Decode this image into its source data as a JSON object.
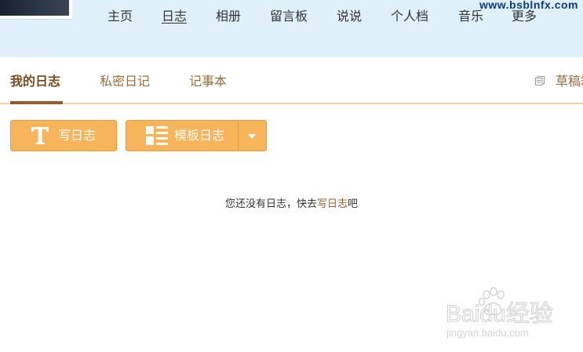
{
  "header": {
    "nav": [
      {
        "label": "主页"
      },
      {
        "label": "日志"
      },
      {
        "label": "相册"
      },
      {
        "label": "留言板"
      },
      {
        "label": "说说"
      },
      {
        "label": "个人档"
      },
      {
        "label": "音乐"
      },
      {
        "label": "更多"
      }
    ],
    "active_nav": "日志",
    "watermark_url": "www.bsblnfx.com"
  },
  "tabs": {
    "items": [
      {
        "label": "我的日志"
      },
      {
        "label": "私密日记"
      },
      {
        "label": "记事本"
      }
    ],
    "active": "我的日志",
    "drafts_label": "草稿箱"
  },
  "toolbar": {
    "write_label": "写日志",
    "template_label": "模板日志"
  },
  "empty_state": {
    "prefix": "您还没有日志，快去",
    "link": "写日志",
    "suffix": "吧"
  },
  "watermark": {
    "brand": "Baidu经验",
    "url": "jingyan.baidu.com"
  },
  "colors": {
    "header_bg": "#dff0fb",
    "accent": "#f7b45a",
    "tab_active": "#7a4b1e",
    "tab_text": "#9a6e3c",
    "rule": "#f0d6a8"
  }
}
